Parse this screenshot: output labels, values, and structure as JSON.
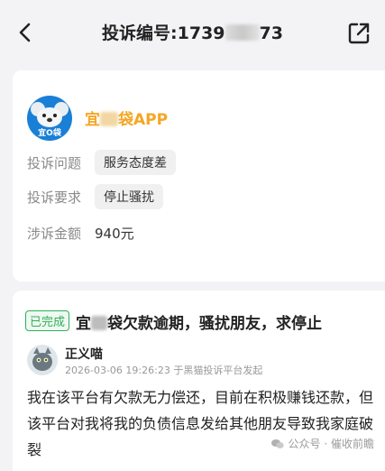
{
  "header": {
    "title_prefix": "投诉编号:1739",
    "title_suffix": "73"
  },
  "app": {
    "name_prefix": "宜",
    "name_suffix": "袋APP",
    "logo_text": "宜O袋"
  },
  "details": {
    "issue_label": "投诉问题",
    "issue_value": "服务态度差",
    "request_label": "投诉要求",
    "request_value": "停止骚扰",
    "amount_label": "涉诉金额",
    "amount_value": "940元"
  },
  "complaint": {
    "status": "已完成",
    "title_prefix": "宜",
    "title_suffix": "袋欠款逾期，骚扰朋友，求停止",
    "user": "正义喵",
    "meta": "2026-03-06 19:26:23 于黑猫投诉平台发起",
    "body": "我在该平台有欠款无力偿还，目前在积极赚钱还款，但该平台对我将我的负债信息发给其他朋友导致我家庭破裂"
  },
  "watermark": {
    "text": "公众号 · 催收前瞻"
  },
  "colors": {
    "accent_orange": "#f5a623",
    "status_green": "#2fb05a",
    "logo_blue": "#1a7fd6"
  }
}
